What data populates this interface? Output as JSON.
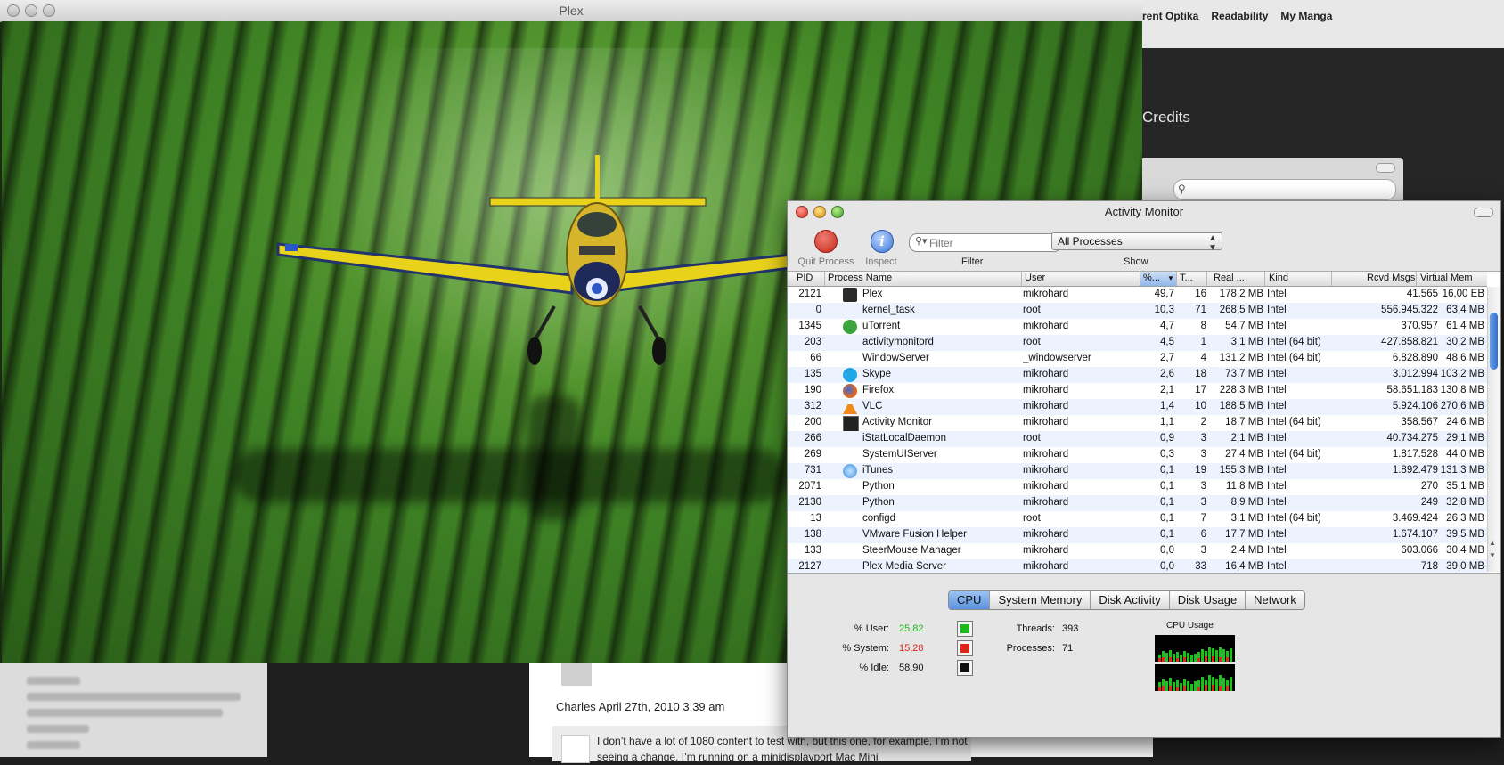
{
  "browser": {
    "bookmarks": [
      "orrent Optika",
      "Readability",
      "My Manga"
    ],
    "site_nav_item": "Credits",
    "comment": {
      "meta": "Charles April 27th, 2010 3:39 am",
      "text": "I don’t have a lot of 1080 content to test with, but this one, for example, I’m not seeing a change. I’m running on a minidisplayport Mac Mini"
    }
  },
  "plex": {
    "title": "Plex"
  },
  "activity_monitor": {
    "title": "Activity Monitor",
    "toolbar": {
      "quit_label": "Quit Process",
      "inspect_label": "Inspect",
      "inspect_glyph": "i",
      "filter_placeholder": "Filter",
      "filter_label": "Filter",
      "show_value": "All Processes",
      "show_label": "Show"
    },
    "columns": [
      "PID",
      "Process Name",
      "User",
      "%...",
      "T...",
      "Real ...",
      "Kind",
      "Rcvd Msgs",
      "Virtual Mem"
    ],
    "processes": [
      {
        "pid": "2121",
        "name": "Plex",
        "user": "mikrohard",
        "cpu": "49,7",
        "threads": "16",
        "real": "178,2 MB",
        "kind": "Intel",
        "rcvd": "41.565",
        "vmem": "16,00 EB",
        "icon": "plex-icon"
      },
      {
        "pid": "0",
        "name": "kernel_task",
        "user": "root",
        "cpu": "10,3",
        "threads": "71",
        "real": "268,5 MB",
        "kind": "Intel",
        "rcvd": "556.945.322",
        "vmem": "63,4 MB",
        "icon": ""
      },
      {
        "pid": "1345",
        "name": "uTorrent",
        "user": "mikrohard",
        "cpu": "4,7",
        "threads": "8",
        "real": "54,7 MB",
        "kind": "Intel",
        "rcvd": "370.957",
        "vmem": "61,4 MB",
        "icon": "utorrent-icon"
      },
      {
        "pid": "203",
        "name": "activitymonitord",
        "user": "root",
        "cpu": "4,5",
        "threads": "1",
        "real": "3,1 MB",
        "kind": "Intel (64 bit)",
        "rcvd": "427.858.821",
        "vmem": "30,2 MB",
        "icon": ""
      },
      {
        "pid": "66",
        "name": "WindowServer",
        "user": "_windowserver",
        "cpu": "2,7",
        "threads": "4",
        "real": "131,2 MB",
        "kind": "Intel (64 bit)",
        "rcvd": "6.828.890",
        "vmem": "48,6 MB",
        "icon": ""
      },
      {
        "pid": "135",
        "name": "Skype",
        "user": "mikrohard",
        "cpu": "2,6",
        "threads": "18",
        "real": "73,7 MB",
        "kind": "Intel",
        "rcvd": "3.012.994",
        "vmem": "103,2 MB",
        "icon": "skype-icon"
      },
      {
        "pid": "190",
        "name": "Firefox",
        "user": "mikrohard",
        "cpu": "2,1",
        "threads": "17",
        "real": "228,3 MB",
        "kind": "Intel",
        "rcvd": "58.651.183",
        "vmem": "130,8 MB",
        "icon": "firefox-icon"
      },
      {
        "pid": "312",
        "name": "VLC",
        "user": "mikrohard",
        "cpu": "1,4",
        "threads": "10",
        "real": "188,5 MB",
        "kind": "Intel",
        "rcvd": "5.924.106",
        "vmem": "270,6 MB",
        "icon": "vlc-icon"
      },
      {
        "pid": "200",
        "name": "Activity Monitor",
        "user": "mikrohard",
        "cpu": "1,1",
        "threads": "2",
        "real": "18,7 MB",
        "kind": "Intel (64 bit)",
        "rcvd": "358.567",
        "vmem": "24,6 MB",
        "icon": "activity-monitor-icon"
      },
      {
        "pid": "266",
        "name": "iStatLocalDaemon",
        "user": "root",
        "cpu": "0,9",
        "threads": "3",
        "real": "2,1 MB",
        "kind": "Intel",
        "rcvd": "40.734.275",
        "vmem": "29,1 MB",
        "icon": ""
      },
      {
        "pid": "269",
        "name": "SystemUIServer",
        "user": "mikrohard",
        "cpu": "0,3",
        "threads": "3",
        "real": "27,4 MB",
        "kind": "Intel (64 bit)",
        "rcvd": "1.817.528",
        "vmem": "44,0 MB",
        "icon": ""
      },
      {
        "pid": "731",
        "name": "iTunes",
        "user": "mikrohard",
        "cpu": "0,1",
        "threads": "19",
        "real": "155,3 MB",
        "kind": "Intel",
        "rcvd": "1.892.479",
        "vmem": "131,3 MB",
        "icon": "itunes-icon"
      },
      {
        "pid": "2071",
        "name": "Python",
        "user": "mikrohard",
        "cpu": "0,1",
        "threads": "3",
        "real": "11,8 MB",
        "kind": "Intel",
        "rcvd": "270",
        "vmem": "35,1 MB",
        "icon": ""
      },
      {
        "pid": "2130",
        "name": "Python",
        "user": "mikrohard",
        "cpu": "0,1",
        "threads": "3",
        "real": "8,9 MB",
        "kind": "Intel",
        "rcvd": "249",
        "vmem": "32,8 MB",
        "icon": ""
      },
      {
        "pid": "13",
        "name": "configd",
        "user": "root",
        "cpu": "0,1",
        "threads": "7",
        "real": "3,1 MB",
        "kind": "Intel (64 bit)",
        "rcvd": "3.469.424",
        "vmem": "26,3 MB",
        "icon": ""
      },
      {
        "pid": "138",
        "name": "VMware Fusion Helper",
        "user": "mikrohard",
        "cpu": "0,1",
        "threads": "6",
        "real": "17,7 MB",
        "kind": "Intel",
        "rcvd": "1.674.107",
        "vmem": "39,5 MB",
        "icon": ""
      },
      {
        "pid": "133",
        "name": "SteerMouse Manager",
        "user": "mikrohard",
        "cpu": "0,0",
        "threads": "3",
        "real": "2,4 MB",
        "kind": "Intel",
        "rcvd": "603.066",
        "vmem": "30,4 MB",
        "icon": ""
      },
      {
        "pid": "2127",
        "name": "Plex Media Server",
        "user": "mikrohard",
        "cpu": "0,0",
        "threads": "33",
        "real": "16,4 MB",
        "kind": "Intel",
        "rcvd": "718",
        "vmem": "39,0 MB",
        "icon": ""
      }
    ],
    "tabs": [
      "CPU",
      "System Memory",
      "Disk Activity",
      "Disk Usage",
      "Network"
    ],
    "active_tab": "CPU",
    "cpu": {
      "user_label": "% User:",
      "user_value": "25,82",
      "user_color": "#1cb81c",
      "system_label": "% System:",
      "system_value": "15,28",
      "system_color": "#d8261a",
      "idle_label": "% Idle:",
      "idle_value": "58,90",
      "idle_color": "#111111",
      "threads_label": "Threads:",
      "threads_value": "393",
      "processes_label": "Processes:",
      "processes_value": "71",
      "usage_title": "CPU Usage"
    }
  }
}
